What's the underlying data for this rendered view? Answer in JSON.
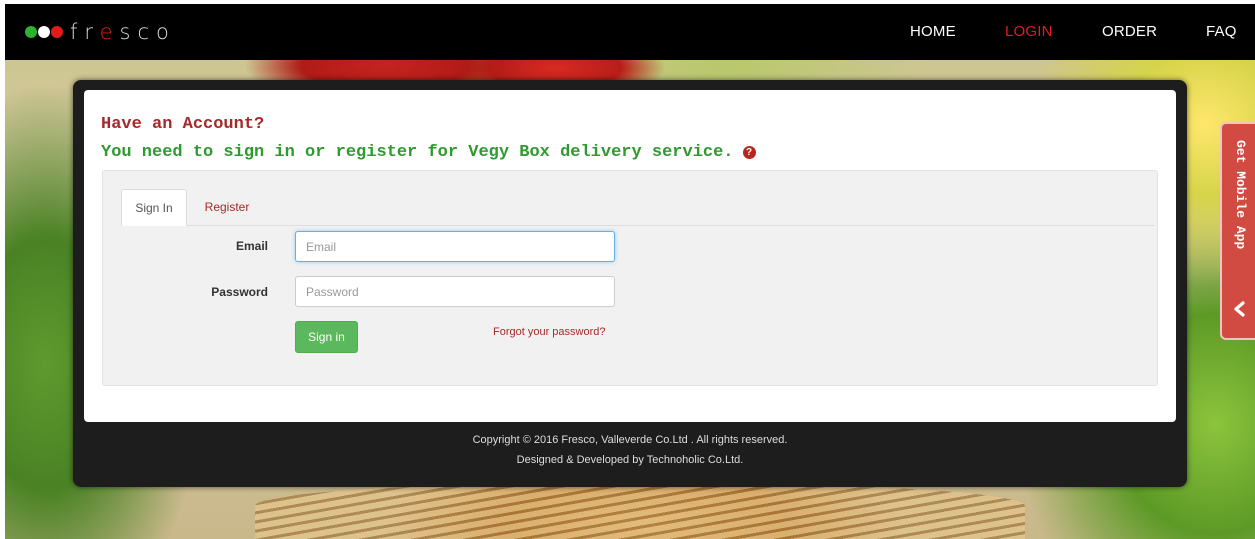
{
  "brand": {
    "name_parts": [
      "fr",
      "e",
      "sco"
    ],
    "dot_colors": [
      "#2fb02f",
      "#ffffff",
      "#e21b1b"
    ]
  },
  "nav": {
    "items": [
      "HOME",
      "LOGIN",
      "ORDER",
      "FAQ"
    ],
    "active": "LOGIN"
  },
  "main": {
    "heading": "Have an Account?",
    "subheading": "You need to sign in or register for Vegy Box delivery service.",
    "help_icon": "question-circle-icon",
    "tabs": [
      "Sign In",
      "Register"
    ],
    "active_tab": "Sign In",
    "form": {
      "email_label": "Email",
      "email_placeholder": "Email",
      "email_value": "",
      "password_label": "Password",
      "password_placeholder": "Password",
      "password_value": "",
      "submit_label": "Sign in",
      "forgot_label": "Forgot your password?"
    }
  },
  "footer": {
    "line1": "Copyright © 2016 Fresco, Valleverde Co.Ltd . All rights reserved.",
    "line2": "Designed & Developed by Technoholic Co.Ltd."
  },
  "side_tab": {
    "label": "Get Mobile App",
    "icon": "chevron-left-icon"
  },
  "colors": {
    "accent_red": "#e21b1b",
    "heading_red": "#a52a2a",
    "heading_green": "#2f9a2f",
    "button_green": "#5cb85c",
    "side_tab": "#d24b43"
  }
}
